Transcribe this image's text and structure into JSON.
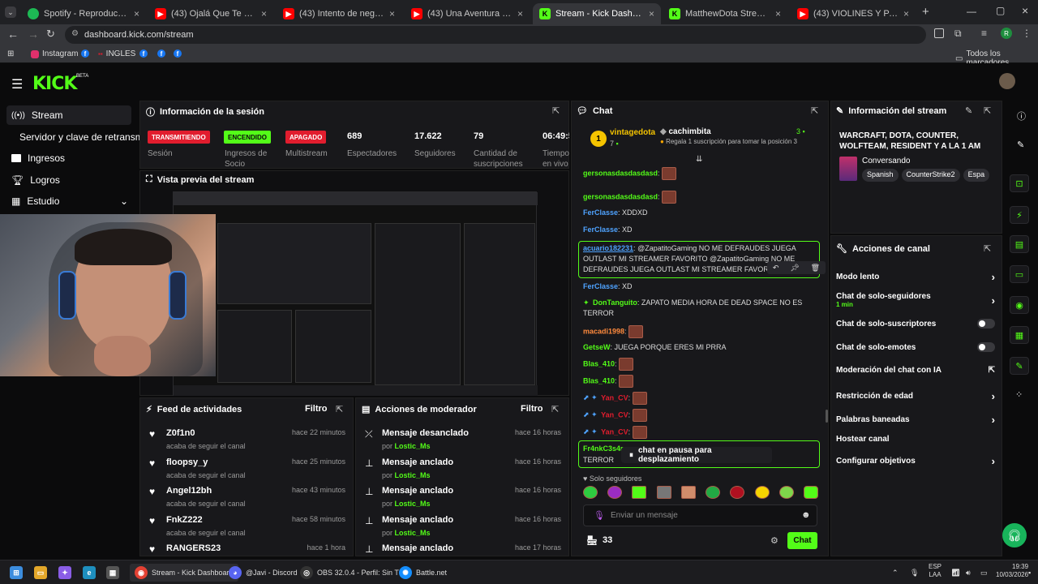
{
  "browser": {
    "tabs": [
      {
        "title": "Spotify - Reproductor web: mú",
        "color": "#1db954",
        "icon": "spotify-icon"
      },
      {
        "title": "(43) Ojalá Que Te Mueras - You",
        "color": "#ff0000",
        "icon": "youtube-icon"
      },
      {
        "title": "(43) Intento de negociación en",
        "color": "#ff0000",
        "icon": "youtube-icon"
      },
      {
        "title": "(43) Una Aventura Más - YouTu",
        "color": "#ff0000",
        "icon": "youtube-icon"
      },
      {
        "title": "Stream - Kick Dashboard",
        "color": "#53fc18",
        "icon": "kick-icon"
      },
      {
        "title": "MatthewDota Stream - Watch l",
        "color": "#53fc18",
        "icon": "kick-icon"
      },
      {
        "title": "(43) VIOLINES Y PARCHADAS",
        "color": "#ff0000",
        "icon": "youtube-icon"
      }
    ],
    "url": "dashboard.kick.com/stream",
    "bookmarks": [
      "Instagram",
      "INGLES"
    ],
    "all_bookmarks": "Todos los marcadores",
    "profile_initial": "R"
  },
  "kick": {
    "logo": "KICK",
    "beta": "BETA",
    "sidebar": [
      {
        "label": "Stream",
        "icon": "broadcast-icon"
      },
      {
        "label": "Servidor y clave de retransmisión",
        "icon": ""
      },
      {
        "label": "Ingresos",
        "icon": "dollar-icon"
      },
      {
        "label": "Logros",
        "icon": "trophy-icon"
      },
      {
        "label": "Estudio",
        "icon": "film-icon"
      }
    ],
    "session": {
      "title": "Información de la sesión",
      "badges": [
        {
          "text": "TRANSMITIENDO",
          "label": "Sesión",
          "bg": "#e11d2e",
          "fg": "#ffffff"
        },
        {
          "text": "ENCENDIDO",
          "label": "Ingresos de Socio",
          "bg": "#53fc18",
          "fg": "#0b0b0c"
        },
        {
          "text": "APAGADO",
          "label": "Multistream",
          "bg": "#e11d2e",
          "fg": "#ffffff"
        }
      ],
      "stats": [
        {
          "value": "689",
          "label": "Espectadores"
        },
        {
          "value": "17.622",
          "label": "Seguidores"
        },
        {
          "value": "79",
          "label": "Cantidad de suscripciones"
        },
        {
          "value": "06:49:5",
          "label": "Tiempo en vivo"
        }
      ]
    },
    "preview_title": "Vista previa del stream",
    "feed": {
      "title": "Feed de actividades",
      "filter": "Filtro",
      "items": [
        {
          "name": "Z0f1n0",
          "sub": "acaba de seguir el canal",
          "time": "hace 22 minutos"
        },
        {
          "name": "floopsy_y",
          "sub": "acaba de seguir el canal",
          "time": "hace 25 minutos"
        },
        {
          "name": "Angel12bh",
          "sub": "acaba de seguir el canal",
          "time": "hace 43 minutos"
        },
        {
          "name": "FnkZ222",
          "sub": "acaba de seguir el canal",
          "time": "hace 58 minutos"
        },
        {
          "name": "RANGERS23",
          "sub": "",
          "time": "hace 1 hora"
        }
      ]
    },
    "modactions": {
      "title": "Acciones de moderador",
      "filter": "Filtro",
      "items": [
        {
          "name": "Mensaje desanclado",
          "by": "por",
          "user": "Lostic_Ms",
          "time": "hace 16 horas"
        },
        {
          "name": "Mensaje anclado",
          "by": "por",
          "user": "Lostic_Ms",
          "time": "hace 16 horas"
        },
        {
          "name": "Mensaje anclado",
          "by": "por",
          "user": "Lostic_Ms",
          "time": "hace 16 horas"
        },
        {
          "name": "Mensaje anclado",
          "by": "por",
          "user": "Lostic_Ms",
          "time": "hace 16 horas"
        },
        {
          "name": "Mensaje anclado",
          "by": "",
          "user": "",
          "time": "hace 17 horas"
        }
      ]
    },
    "chat": {
      "title": "Chat",
      "gifter1": {
        "name": "vintagedota",
        "count": "7",
        "rank": "1"
      },
      "gifter2": {
        "name": "cachimbita",
        "count": "3",
        "note": "Regala 1 suscripción para tomar la posición 3"
      },
      "messages": [
        {
          "user": "gersonasdasdasdasd",
          "color": "#53fc18",
          "text": "",
          "emote": true
        },
        {
          "user": "gersonasdasdasdasd",
          "color": "#53fc18",
          "text": "",
          "emote": true
        },
        {
          "user": "FerClasse",
          "color": "#4fa3ff",
          "text": "XDDXD",
          "emote": false
        },
        {
          "user": "FerClasse",
          "color": "#4fa3ff",
          "text": "XD",
          "emote": false
        },
        {
          "user": "acuario182231",
          "color": "#4fa3ff",
          "text": "@ZapatitoGaming NO ME DEFRAUDES JUEGA OUTLAST MI STREAMER FAVORITO @ZapatitoGaming NO ME DEFRAUDES JUEGA OUTLAST MI STREAMER FAVORITO",
          "emote": false
        },
        {
          "user": "FerClasse",
          "color": "#4fa3ff",
          "text": "XD",
          "emote": false
        },
        {
          "user": "DonTanguito",
          "color": "#53fc18",
          "text": "ZAPATO MEDIA HORA DE DEAD SPACE NO ES TERROR",
          "emote": false
        },
        {
          "user": "macadi1998",
          "color": "#ff8a3d",
          "text": "",
          "emote": true
        },
        {
          "user": "GetseW",
          "color": "#53fc18",
          "text": "JUEGA PORQUE ERES MI PRRA",
          "emote": false
        },
        {
          "user": "Blas_410",
          "color": "#53fc18",
          "text": "",
          "emote": true
        },
        {
          "user": "Blas_410",
          "color": "#53fc18",
          "text": "",
          "emote": true
        },
        {
          "user": "Yan_CV",
          "color": "#e11d2e",
          "text": "",
          "emote": true
        },
        {
          "user": "Yan_CV",
          "color": "#e11d2e",
          "text": "",
          "emote": true
        },
        {
          "user": "Yan_CV",
          "color": "#e11d2e",
          "text": "",
          "emote": true
        }
      ],
      "pinned_user": "Fr4nkC3s4r",
      "pinned_text": "TERROR",
      "paused": "chat en pausa para desplazamiento",
      "followers_only": "Solo seguidores",
      "input_placeholder": "Enviar un mensaje",
      "viewers": "33",
      "send": "Chat"
    },
    "streaminfo": {
      "title": "Información del stream",
      "stream_title": "WARCRAFT, DOTA, COUNTER, WOLFTEAM, RESIDENT Y A LA 1 AM IRL...",
      "category": "Conversando",
      "tags": [
        "Spanish",
        "CounterStrike2",
        "Espa"
      ]
    },
    "channel_actions": {
      "title": "Acciones de canal",
      "items": [
        {
          "label": "Modo lento",
          "sub": "",
          "control": "chevron"
        },
        {
          "label": "Chat de solo-seguidores",
          "sub": "1 min",
          "control": "chevron"
        },
        {
          "label": "Chat de solo-suscriptores",
          "sub": "",
          "control": "toggle"
        },
        {
          "label": "Chat de solo-emotes",
          "sub": "",
          "control": "toggle"
        },
        {
          "label": "Moderación del chat con IA",
          "sub": "",
          "control": "external"
        },
        {
          "label": "Restricción de edad",
          "sub": "",
          "control": "chevron"
        },
        {
          "label": "Palabras baneadas",
          "sub": "",
          "control": "chevron"
        },
        {
          "label": "Hostear canal",
          "sub": "",
          "control": "none"
        },
        {
          "label": "Configurar objetivos",
          "sub": "",
          "control": "chevron"
        }
      ]
    }
  },
  "taskbar": {
    "apps": [
      {
        "label": "Stream - Kick Dashboard",
        "color": "#3c8dde"
      },
      {
        "label": "@Javi - Discord",
        "color": "#5865f2"
      },
      {
        "label": "OBS 32.0.4 - Perfil: Sin T",
        "color": "#333333"
      },
      {
        "label": "Battle.net",
        "color": "#148eff"
      }
    ],
    "lang": "ESP",
    "lang2": "LAA",
    "time": "19:39",
    "date": "10/03/2026"
  }
}
